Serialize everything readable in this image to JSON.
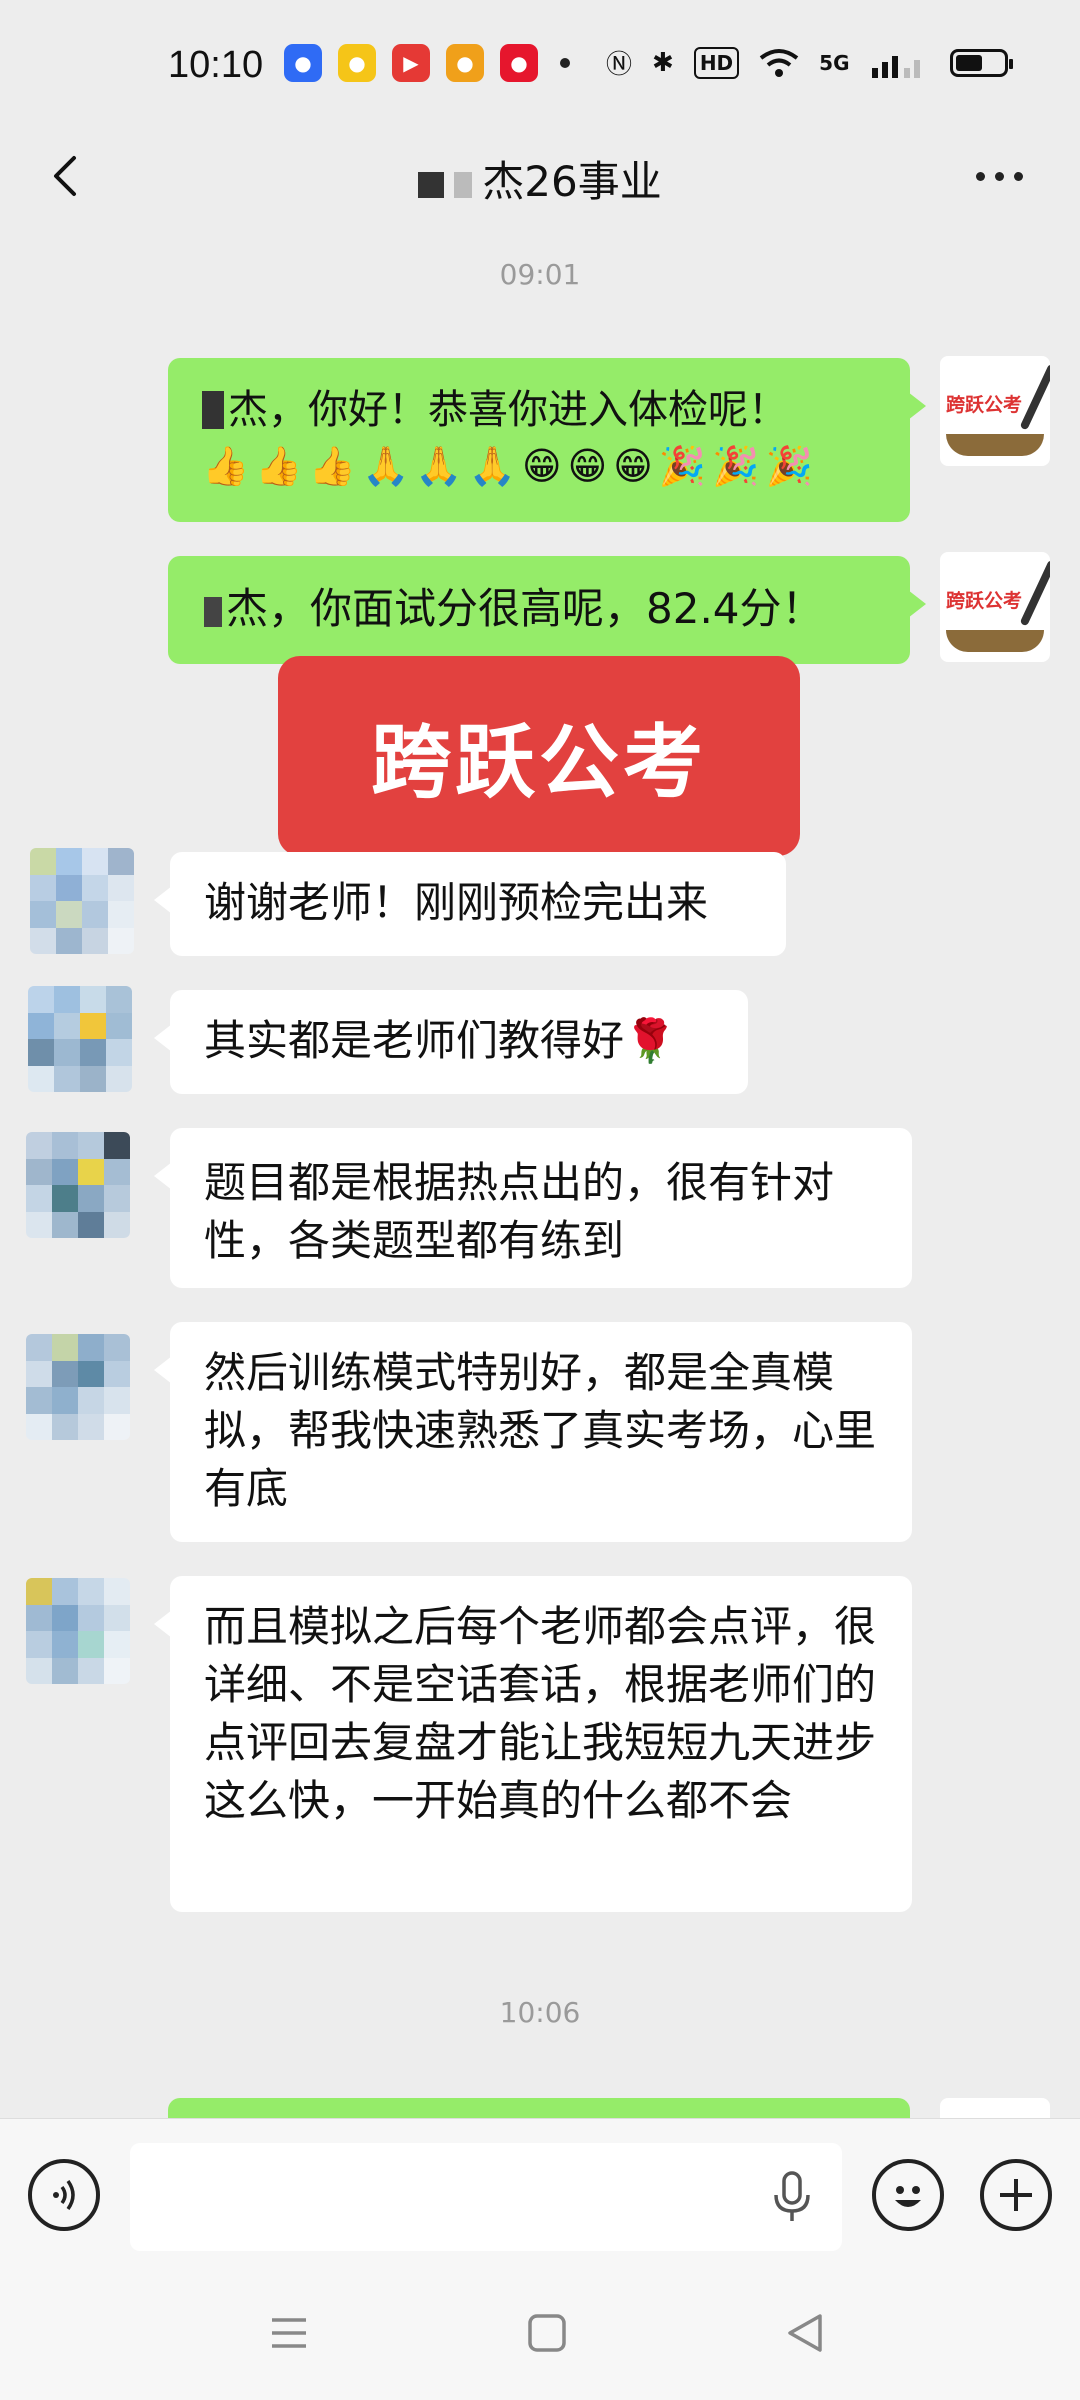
{
  "status_bar": {
    "time": "10:10",
    "apps": [
      {
        "icon": "baidu-icon",
        "color": "#2f6bf5",
        "glyph": "●"
      },
      {
        "icon": "music-icon",
        "color": "#f5c518",
        "glyph": "●"
      },
      {
        "icon": "video-icon",
        "color": "#e53935",
        "glyph": "▶"
      },
      {
        "icon": "sogou-icon",
        "color": "#f0a01a",
        "glyph": "●"
      },
      {
        "icon": "weibo-icon",
        "color": "#e6162d",
        "glyph": "●"
      }
    ],
    "network_label": "5G",
    "hd_label": "HD",
    "battery_level": 0.5
  },
  "header": {
    "title": "杰26事业"
  },
  "timestamps": [
    "09:01",
    "10:06"
  ],
  "messages": [
    {
      "dir": "out",
      "text": "杰，你好！恭喜你进入体检呢！",
      "emojis": [
        "👍",
        "👍",
        "👍",
        "🙏",
        "🙏",
        "🙏",
        "😁",
        "😁",
        "😁",
        "🎉",
        "🎉",
        "🎉"
      ]
    },
    {
      "dir": "out",
      "text": "杰，你面试分很高呢，82.4分！"
    },
    {
      "dir": "in",
      "text": "谢谢老师！刚刚预检完出来"
    },
    {
      "dir": "in",
      "text": "其实都是老师们教得好🌹"
    },
    {
      "dir": "in",
      "text": "题目都是根据热点出的，很有针对性，各类题型都有练到"
    },
    {
      "dir": "in",
      "text": "然后训练模式特别好，都是全真模拟，帮我快速熟悉了真实考场，心里有底"
    },
    {
      "dir": "in",
      "text": "而且模拟之后每个老师都会点评，很详细、不是空话套话，根据老师们的点评回去复盘才能让我短短九天进步这么快，一开始真的什么都不会"
    }
  ],
  "avatar_me": {
    "brand": "跨跃公考"
  },
  "banner": {
    "text": "跨跃公考"
  },
  "input": {
    "value": "",
    "placeholder": ""
  },
  "colors": {
    "outgoing": "#95ec69",
    "incoming": "#ffffff",
    "background": "#ededed",
    "banner": "#e2413f"
  }
}
